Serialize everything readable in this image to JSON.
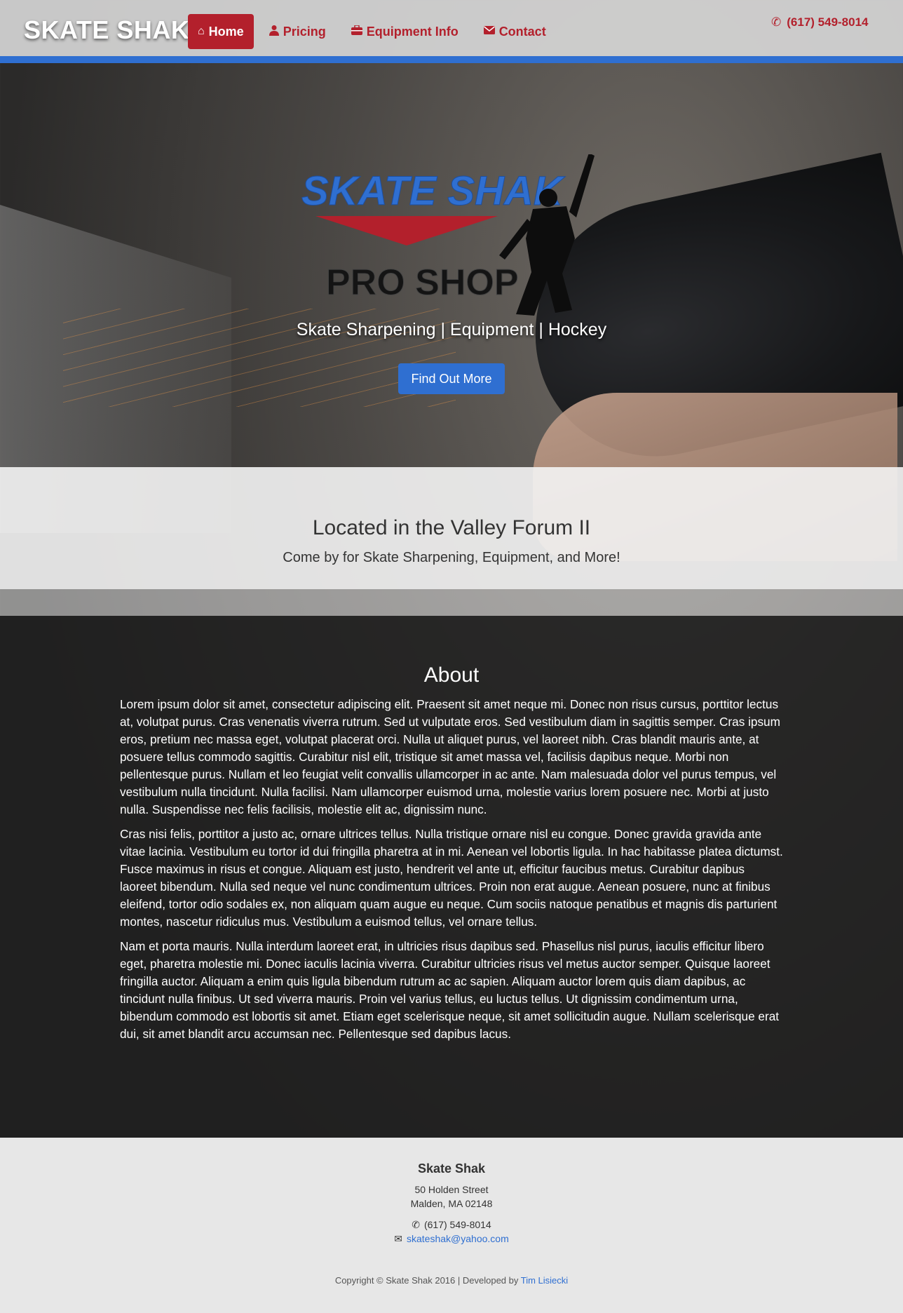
{
  "header": {
    "brand": "SKATE SHAK",
    "nav": [
      {
        "label": "Home",
        "icon": "home-icon",
        "active": true
      },
      {
        "label": "Pricing",
        "icon": "user-icon"
      },
      {
        "label": "Equipment Info",
        "icon": "briefcase-icon"
      },
      {
        "label": "Contact",
        "icon": "envelope-icon"
      }
    ],
    "phone": "(617) 549-8014"
  },
  "hero": {
    "logo_top": "SKATE SHAK",
    "logo_bottom": "PRO SHOP",
    "tagline": "Skate Sharpening | Equipment | Hockey",
    "button": "Find Out More"
  },
  "located": {
    "heading": "Located in the Valley Forum II",
    "subheading": "Come by for Skate Sharpening, Equipment, and More!"
  },
  "about": {
    "heading": "About",
    "paragraphs": [
      "Lorem ipsum dolor sit amet, consectetur adipiscing elit. Praesent sit amet neque mi. Donec non risus cursus, porttitor lectus at, volutpat purus. Cras venenatis viverra rutrum. Sed ut vulputate eros. Sed vestibulum diam in sagittis semper. Cras ipsum eros, pretium nec massa eget, volutpat placerat orci. Nulla ut aliquet purus, vel laoreet nibh. Cras blandit mauris ante, at posuere tellus commodo sagittis. Curabitur nisl elit, tristique sit amet massa vel, facilisis dapibus neque. Morbi non pellentesque purus. Nullam et leo feugiat velit convallis ullamcorper in ac ante. Nam malesuada dolor vel purus tempus, vel vestibulum nulla tincidunt. Nulla facilisi. Nam ullamcorper euismod urna, molestie varius lorem posuere nec. Morbi at justo nulla. Suspendisse nec felis facilisis, molestie elit ac, dignissim nunc.",
      "Cras nisi felis, porttitor a justo ac, ornare ultrices tellus. Nulla tristique ornare nisl eu congue. Donec gravida gravida ante vitae lacinia. Vestibulum eu tortor id dui fringilla pharetra at in mi. Aenean vel lobortis ligula. In hac habitasse platea dictumst. Fusce maximus in risus et congue. Aliquam est justo, hendrerit vel ante ut, efficitur faucibus metus. Curabitur dapibus laoreet bibendum. Nulla sed neque vel nunc condimentum ultrices. Proin non erat augue. Aenean posuere, nunc at finibus eleifend, tortor odio sodales ex, non aliquam quam augue eu neque. Cum sociis natoque penatibus et magnis dis parturient montes, nascetur ridiculus mus. Vestibulum a euismod tellus, vel ornare tellus.",
      "Nam et porta mauris. Nulla interdum laoreet erat, in ultricies risus dapibus sed. Phasellus nisl purus, iaculis efficitur libero eget, pharetra molestie mi. Donec iaculis lacinia viverra. Curabitur ultricies risus vel metus auctor semper. Quisque laoreet fringilla auctor. Aliquam a enim quis ligula bibendum rutrum ac ac sapien. Aliquam auctor lorem quis diam dapibus, ac tincidunt nulla finibus. Ut sed viverra mauris. Proin vel varius tellus, eu luctus tellus. Ut dignissim condimentum urna, bibendum commodo est lobortis sit amet. Etiam eget scelerisque neque, sit amet sollicitudin augue. Nullam scelerisque erat dui, sit amet blandit arcu accumsan nec. Pellentesque sed dapibus lacus."
    ]
  },
  "footer": {
    "name": "Skate Shak",
    "street": "50 Holden Street",
    "city": "Malden, MA 02148",
    "phone": "(617) 549-8014",
    "email": "skateshak@yahoo.com",
    "copyright_prefix": "Copyright © Skate Shak 2016 | Developed by",
    "developer": "Tim Lisiecki"
  },
  "colors": {
    "brand_red": "#b3202c",
    "accent_blue": "#2f6fd1"
  }
}
